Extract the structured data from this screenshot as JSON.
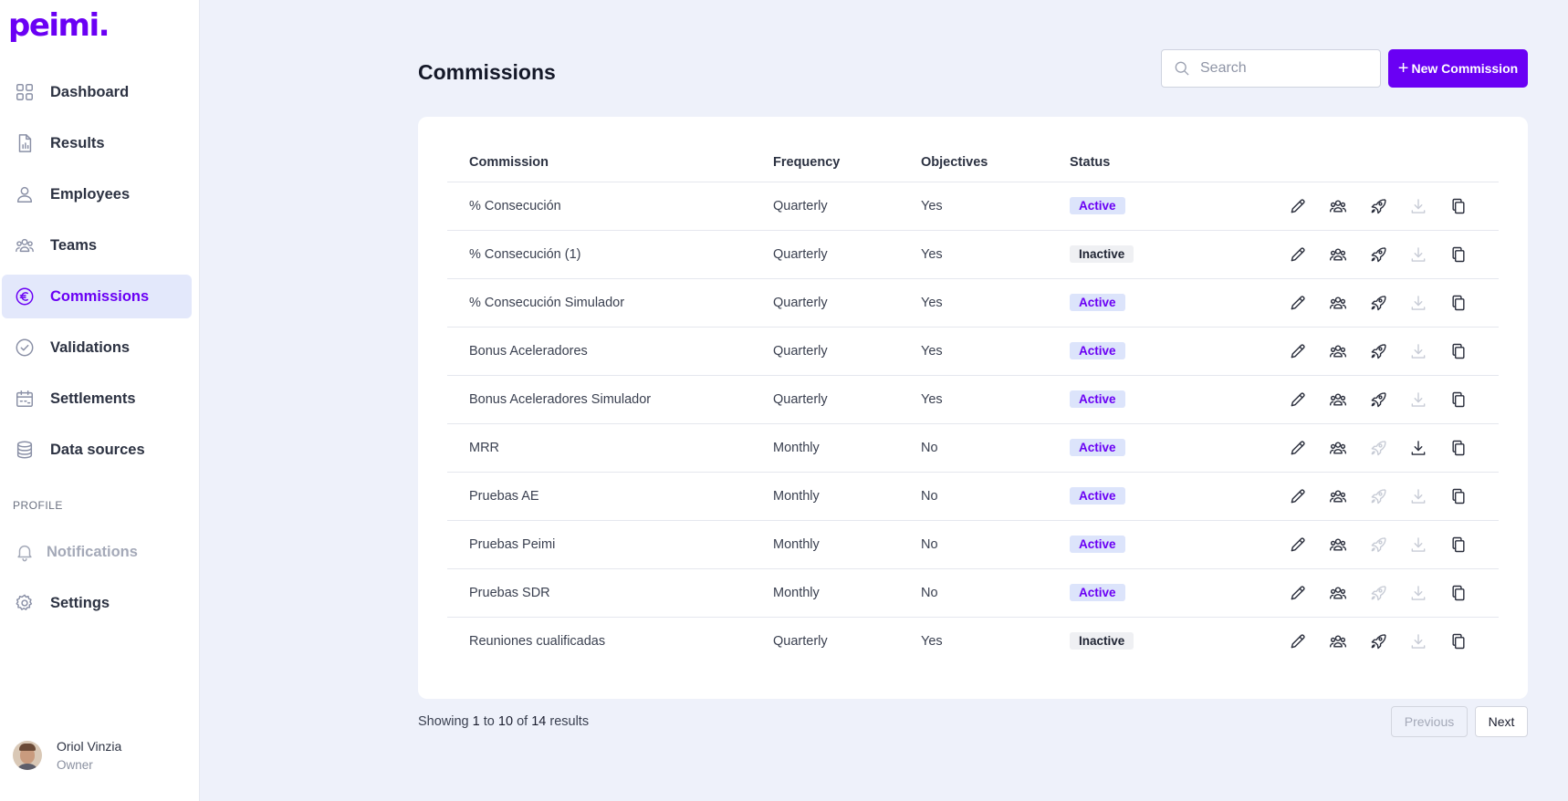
{
  "app": {
    "logo": "peimi."
  },
  "sidebar": {
    "items": [
      {
        "label": "Dashboard",
        "icon": "grid-icon",
        "active": false
      },
      {
        "label": "Results",
        "icon": "report-icon",
        "active": false
      },
      {
        "label": "Employees",
        "icon": "user-icon",
        "active": false
      },
      {
        "label": "Teams",
        "icon": "team-icon",
        "active": false
      },
      {
        "label": "Commissions",
        "icon": "euro-icon",
        "active": true
      },
      {
        "label": "Validations",
        "icon": "check-circle-icon",
        "active": false
      },
      {
        "label": "Settlements",
        "icon": "calendar-icon",
        "active": false
      },
      {
        "label": "Data sources",
        "icon": "database-icon",
        "active": false
      }
    ],
    "profile_label": "PROFILE",
    "profile_items": [
      {
        "label": "Notifications",
        "icon": "bell-icon",
        "disabled": true
      },
      {
        "label": "Settings",
        "icon": "gear-icon",
        "disabled": false
      }
    ],
    "user": {
      "name": "Oriol Vinzia",
      "role": "Owner"
    }
  },
  "header": {
    "title": "Commissions",
    "search_placeholder": "Search",
    "new_button": "New Commission"
  },
  "table": {
    "columns": [
      "Commission",
      "Frequency",
      "Objectives",
      "Status"
    ],
    "rows": [
      {
        "name": "% Consecución",
        "frequency": "Quarterly",
        "objectives": "Yes",
        "status": "Active",
        "launch_enabled": true,
        "download_enabled": false
      },
      {
        "name": "% Consecución (1)",
        "frequency": "Quarterly",
        "objectives": "Yes",
        "status": "Inactive",
        "launch_enabled": true,
        "download_enabled": false
      },
      {
        "name": "% Consecución Simulador",
        "frequency": "Quarterly",
        "objectives": "Yes",
        "status": "Active",
        "launch_enabled": true,
        "download_enabled": false
      },
      {
        "name": "Bonus Aceleradores",
        "frequency": "Quarterly",
        "objectives": "Yes",
        "status": "Active",
        "launch_enabled": true,
        "download_enabled": false
      },
      {
        "name": "Bonus Aceleradores Simulador",
        "frequency": "Quarterly",
        "objectives": "Yes",
        "status": "Active",
        "launch_enabled": true,
        "download_enabled": false
      },
      {
        "name": "MRR",
        "frequency": "Monthly",
        "objectives": "No",
        "status": "Active",
        "launch_enabled": false,
        "download_enabled": true
      },
      {
        "name": "Pruebas AE",
        "frequency": "Monthly",
        "objectives": "No",
        "status": "Active",
        "launch_enabled": false,
        "download_enabled": false
      },
      {
        "name": "Pruebas Peimi",
        "frequency": "Monthly",
        "objectives": "No",
        "status": "Active",
        "launch_enabled": false,
        "download_enabled": false
      },
      {
        "name": "Pruebas SDR",
        "frequency": "Monthly",
        "objectives": "No",
        "status": "Active",
        "launch_enabled": false,
        "download_enabled": false
      },
      {
        "name": "Reuniones cualificadas",
        "frequency": "Quarterly",
        "objectives": "Yes",
        "status": "Inactive",
        "launch_enabled": true,
        "download_enabled": false
      }
    ]
  },
  "pagination": {
    "showing": "Showing",
    "from": "1",
    "to_word": "to",
    "to": "10",
    "of_word": "of",
    "total": "14",
    "results_word": "results",
    "previous": "Previous",
    "next": "Next"
  },
  "colors": {
    "accent": "#6a00f4",
    "background": "#eef1fa",
    "active_badge_bg": "#dce4fb"
  }
}
